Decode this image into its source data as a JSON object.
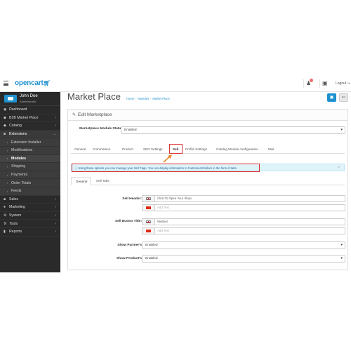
{
  "topbar": {
    "logo": "opencart",
    "logout_label": "Logout"
  },
  "profile": {
    "name": "John Doe",
    "role": "Administrator"
  },
  "sidebar": {
    "items": [
      {
        "label": "Dashboard",
        "icon": "dashboard-icon",
        "has_chevron": false
      },
      {
        "label": "B2B Market Place",
        "icon": "store-icon",
        "has_chevron": true
      },
      {
        "label": "Catalog",
        "icon": "tag-icon",
        "has_chevron": true
      },
      {
        "label": "Extensions",
        "icon": "puzzle-icon",
        "has_chevron": true,
        "active": true
      },
      {
        "label": "Extension Installer",
        "sub": true
      },
      {
        "label": "Modifications",
        "sub": true
      },
      {
        "label": "Modules",
        "sub": true,
        "current": true
      },
      {
        "label": "Shipping",
        "sub": true
      },
      {
        "label": "Payments",
        "sub": true
      },
      {
        "label": "Order Totals",
        "sub": true
      },
      {
        "label": "Feeds",
        "sub": true
      },
      {
        "label": "Sales",
        "icon": "cart-icon",
        "has_chevron": true
      },
      {
        "label": "Marketing",
        "icon": "share-icon",
        "has_chevron": true
      },
      {
        "label": "System",
        "icon": "gear-icon",
        "has_chevron": true
      },
      {
        "label": "Tools",
        "icon": "wrench-icon",
        "has_chevron": true
      },
      {
        "label": "Reports",
        "icon": "chart-icon",
        "has_chevron": true
      }
    ]
  },
  "page": {
    "title": "Market Place",
    "breadcrumb": [
      "Home",
      "Modules",
      "Market Place"
    ]
  },
  "panel": {
    "heading": "Edit Marketplace",
    "status_label": "Marketplace Module Status",
    "status_value": "Enabled",
    "tabs": [
      "General",
      "Commission",
      "Product",
      "SEO Settings",
      "Sell",
      "Profile Settings",
      "Catalog Module configuration",
      "Mail"
    ],
    "active_tab": "Sell",
    "alert": "Using these options you can manage your Sell Page. You can display information to Customers/Sellers in the form of tabs.",
    "subtabs": [
      "General",
      "Sell Tabs"
    ],
    "fields": {
      "sell_header_label": "Sell Header:",
      "sell_header_en": "Click To Open Your Shop",
      "sell_header_cn_placeholder": "Add Text",
      "sell_button_label": "Sell Button Title:",
      "sell_button_en": "Webkul",
      "sell_button_cn_placeholder": "Add Text",
      "show_partners_label": "Show Partner's",
      "show_partners_value": "Enabled",
      "show_products_label": "Show Product's",
      "show_products_value": "Enabled"
    }
  },
  "colors": {
    "accent": "#1e91cf",
    "sidebar": "#2a2a2a",
    "highlight": "#dd3333",
    "alert_bg": "#dff3fb"
  }
}
